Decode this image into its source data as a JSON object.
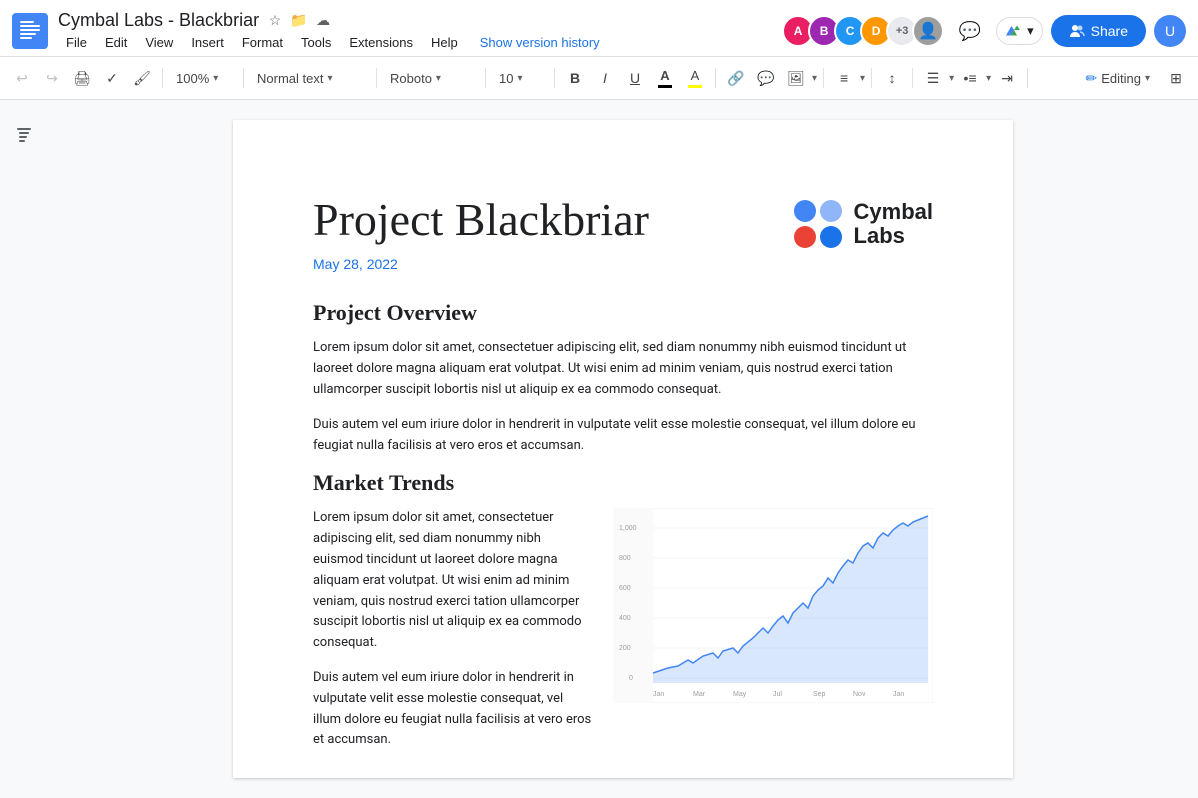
{
  "app": {
    "doc_icon_color": "#1a73e8",
    "title": "Cymbal Labs - Blackbriar",
    "starred": false
  },
  "menu": {
    "file": "File",
    "edit": "Edit",
    "view": "View",
    "insert": "Insert",
    "format": "Format",
    "tools": "Tools",
    "extensions": "Extensions",
    "help": "Help",
    "version_history": "Show version history"
  },
  "toolbar": {
    "zoom": "100%",
    "style": "Normal text",
    "font": "Roboto",
    "size": "10",
    "editing_label": "Editing"
  },
  "document": {
    "title": "Project Blackbriar",
    "date": "May 28, 2022",
    "logo_name1": "Cymbal",
    "logo_name2": "Labs",
    "sections": [
      {
        "heading": "Project Overview",
        "paragraphs": [
          "Lorem ipsum dolor sit amet, consectetuer adipiscing elit, sed diam nonummy nibh euismod tincidunt ut laoreet dolore magna aliquam erat volutpat. Ut wisi enim ad minim veniam, quis nostrud exerci tation ullamcorper suscipit lobortis nisl ut aliquip ex ea commodo consequat.",
          "Duis autem vel eum iriure dolor in hendrerit in vulputate velit esse molestie consequat, vel illum dolore eu feugiat nulla facilisis at vero eros et accumsan."
        ]
      },
      {
        "heading": "Market Trends",
        "paragraphs": [
          "Lorem ipsum dolor sit amet, consectetuer adipiscing elit, sed diam nonummy nibh euismod tincidunt ut laoreet dolore magna aliquam erat volutpat. Ut wisi enim ad minim veniam, quis nostrud exerci tation ullamcorper suscipit lobortis nisl ut aliquip ex ea commodo consequat.",
          "Duis autem vel eum iriure dolor in hendrerit in vulputate velit esse molestie consequat, vel illum dolore eu feugiat nulla facilisis at vero eros et accumsan."
        ]
      }
    ]
  },
  "share_button": {
    "label": "Share"
  },
  "avatars": [
    {
      "initials": "A",
      "color": "#e91e63"
    },
    {
      "initials": "B",
      "color": "#9c27b0"
    },
    {
      "initials": "C",
      "color": "#2196f3"
    },
    {
      "initials": "D",
      "color": "#ff9800"
    },
    {
      "initials": "+3",
      "color": "#e8eaed",
      "text_color": "#5f6368"
    }
  ]
}
